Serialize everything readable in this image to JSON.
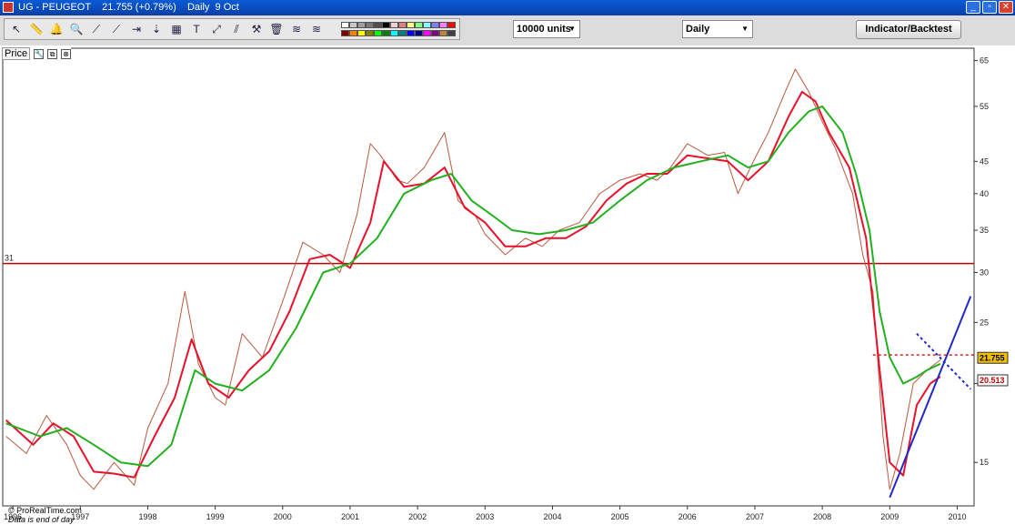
{
  "window": {
    "title": "UG - PEUGEOT    21.755 (+0.79%)    Daily  9 Oct",
    "minimize": "_",
    "restore": "▫",
    "close": "✕"
  },
  "toolbar": {
    "tools": [
      "↖",
      "📏",
      "🔔",
      "🔍",
      "⟋",
      "⟋",
      "⇥",
      "⇣",
      "▦",
      "T",
      "⤢",
      "⫽",
      "⚒",
      "🗑",
      "≋",
      "≋"
    ],
    "swatch_colors": [
      "#ffffff",
      "#c8c8c8",
      "#a0a0a0",
      "#787878",
      "#505050",
      "#000000",
      "#f0d0d0",
      "#e08080",
      "#ffff80",
      "#80ff80",
      "#80ffff",
      "#8080ff",
      "#ff80ff",
      "#ff0000",
      "#800000",
      "#ff8000",
      "#ffff00",
      "#808000",
      "#00ff00",
      "#008000",
      "#00ffff",
      "#008080",
      "#0000ff",
      "#000080",
      "#ff00ff",
      "#800080",
      "#c08040",
      "#404040"
    ],
    "units_label": "10000 units",
    "period_label": "Daily",
    "indicator_button": "Indicator/Backtest"
  },
  "panel": {
    "label": "Price",
    "wrench_icon": "🔧",
    "window_icon": "⧉",
    "close_icon": "⊗",
    "credit": "© ProRealTime.com",
    "credit_note": "Data is end of day"
  },
  "colors": {
    "price": "#b85a3c",
    "ma_fast": "#e8102a",
    "ma_slow": "#22b020",
    "hline": "#c00000",
    "trend": "#1f28c8",
    "bg": "#ffffff"
  },
  "chart_data": {
    "type": "line",
    "title": "",
    "xlabel": "",
    "ylabel": "",
    "y_scale": "log",
    "ylim": [
      12.8,
      68
    ],
    "x_ticks": [
      "1996",
      "1997",
      "1998",
      "1999",
      "2000",
      "2001",
      "2002",
      "2003",
      "2004",
      "2005",
      "2006",
      "2007",
      "2008",
      "2009",
      "2010"
    ],
    "y_ticks": [
      15,
      20,
      25,
      30,
      35,
      40,
      45,
      55,
      65
    ],
    "horizontal_line": {
      "value": 31,
      "label": "31"
    },
    "price_markers": [
      {
        "value": 21.755,
        "label": "21.755",
        "color": "#f0c000"
      },
      {
        "value": 20.513,
        "label": "20.513",
        "color": "#ffffff"
      }
    ],
    "series": [
      {
        "name": "",
        "x": [
          1995.9,
          1996.2,
          1996.5,
          1996.8,
          1997.0,
          1997.2,
          1997.5,
          1997.8,
          1998.0,
          1998.3,
          1998.55,
          1998.75,
          1999.0,
          1999.15,
          1999.4,
          1999.7,
          2000.0,
          2000.3,
          2000.6,
          2000.85,
          2001.1,
          2001.3,
          2001.45,
          2001.7,
          2001.85,
          2002.1,
          2002.4,
          2002.6,
          2002.85,
          2003.0,
          2003.3,
          2003.6,
          2003.85,
          2004.1,
          2004.4,
          2004.7,
          2005.0,
          2005.3,
          2005.55,
          2005.75,
          2006.0,
          2006.3,
          2006.55,
          2006.75,
          2007.0,
          2007.2,
          2007.45,
          2007.6,
          2007.8,
          2008.0,
          2008.2,
          2008.45,
          2008.6,
          2008.75,
          2008.9,
          2009.0,
          2009.15,
          2009.35,
          2009.55,
          2009.75
        ],
        "y": [
          16.5,
          15.5,
          17.8,
          16.0,
          14.3,
          13.6,
          15.0,
          13.8,
          17.0,
          20.0,
          28.0,
          21.5,
          19.0,
          18.5,
          24.0,
          22.0,
          27.0,
          33.5,
          32.0,
          30.0,
          37.0,
          48.0,
          46.0,
          42.0,
          41.5,
          44.0,
          50.0,
          39.0,
          37.0,
          34.5,
          32.0,
          34.0,
          33.0,
          35.0,
          36.0,
          40.0,
          42.0,
          43.0,
          42.0,
          44.0,
          48.0,
          46.0,
          46.5,
          40.0,
          45.5,
          50.0,
          58.0,
          63.0,
          58.0,
          52.0,
          47.0,
          40.0,
          32.0,
          28.0,
          16.5,
          13.6,
          15.5,
          20.0,
          21.0,
          21.8
        ]
      },
      {
        "name": "",
        "x": [
          1995.9,
          1996.3,
          1996.6,
          1996.9,
          1997.2,
          1997.5,
          1997.8,
          1998.1,
          1998.4,
          1998.65,
          1998.9,
          1999.2,
          1999.5,
          1999.8,
          2000.1,
          2000.4,
          2000.7,
          2001.0,
          2001.3,
          2001.5,
          2001.8,
          2002.1,
          2002.4,
          2002.7,
          2003.0,
          2003.3,
          2003.6,
          2003.9,
          2004.2,
          2004.5,
          2004.8,
          2005.1,
          2005.4,
          2005.7,
          2006.0,
          2006.3,
          2006.6,
          2006.9,
          2007.2,
          2007.5,
          2007.7,
          2007.9,
          2008.1,
          2008.4,
          2008.65,
          2008.85,
          2009.0,
          2009.2,
          2009.4,
          2009.6,
          2009.75
        ],
        "y": [
          17.5,
          16.0,
          17.3,
          16.5,
          14.5,
          14.4,
          14.2,
          16.5,
          19.0,
          23.5,
          20.0,
          19.0,
          21.0,
          22.5,
          26.0,
          31.5,
          32.0,
          30.5,
          36.0,
          45.0,
          41.0,
          41.5,
          44.0,
          38.0,
          36.0,
          33.0,
          33.0,
          34.0,
          34.0,
          35.5,
          39.0,
          41.5,
          43.0,
          43.0,
          46.0,
          45.5,
          45.0,
          42.0,
          45.0,
          53.0,
          58.0,
          56.0,
          50.0,
          44.0,
          34.0,
          21.0,
          15.0,
          14.3,
          18.5,
          20.0,
          20.513
        ]
      },
      {
        "name": "",
        "x": [
          1995.9,
          1996.4,
          1996.8,
          1997.2,
          1997.6,
          1998.0,
          1998.35,
          1998.7,
          1999.0,
          1999.4,
          1999.8,
          2000.2,
          2000.6,
          2001.0,
          2001.4,
          2001.8,
          2002.2,
          2002.5,
          2002.8,
          2003.1,
          2003.4,
          2003.8,
          2004.2,
          2004.6,
          2005.0,
          2005.4,
          2005.8,
          2006.2,
          2006.6,
          2006.9,
          2007.2,
          2007.5,
          2007.8,
          2008.0,
          2008.3,
          2008.5,
          2008.7,
          2008.85,
          2009.0,
          2009.2,
          2009.4,
          2009.55,
          2009.75
        ],
        "y": [
          17.3,
          16.5,
          17.0,
          16.0,
          15.0,
          14.8,
          16.0,
          21.0,
          20.0,
          19.5,
          21.0,
          24.5,
          30.0,
          31.0,
          34.0,
          40.0,
          42.0,
          43.0,
          39.0,
          37.0,
          35.0,
          34.5,
          35.0,
          36.0,
          39.0,
          42.0,
          44.0,
          45.0,
          46.0,
          44.0,
          45.0,
          50.0,
          54.0,
          55.0,
          50.0,
          43.0,
          35.0,
          26.0,
          22.0,
          20.0,
          20.5,
          21.0,
          21.5
        ]
      }
    ],
    "annotations": [
      {
        "type": "trendline",
        "color": "#1f28c8",
        "style": "solid",
        "points": [
          [
            2009.0,
            13.2
          ],
          [
            2010.2,
            27.5
          ]
        ]
      },
      {
        "type": "trendline",
        "color": "#1f28c8",
        "style": "dotted",
        "points": [
          [
            2009.4,
            24.0
          ],
          [
            2010.2,
            19.6
          ]
        ]
      },
      {
        "type": "hline",
        "color": "#e02020",
        "style": "dotted",
        "value": 22.2,
        "from": 2008.75
      }
    ]
  }
}
